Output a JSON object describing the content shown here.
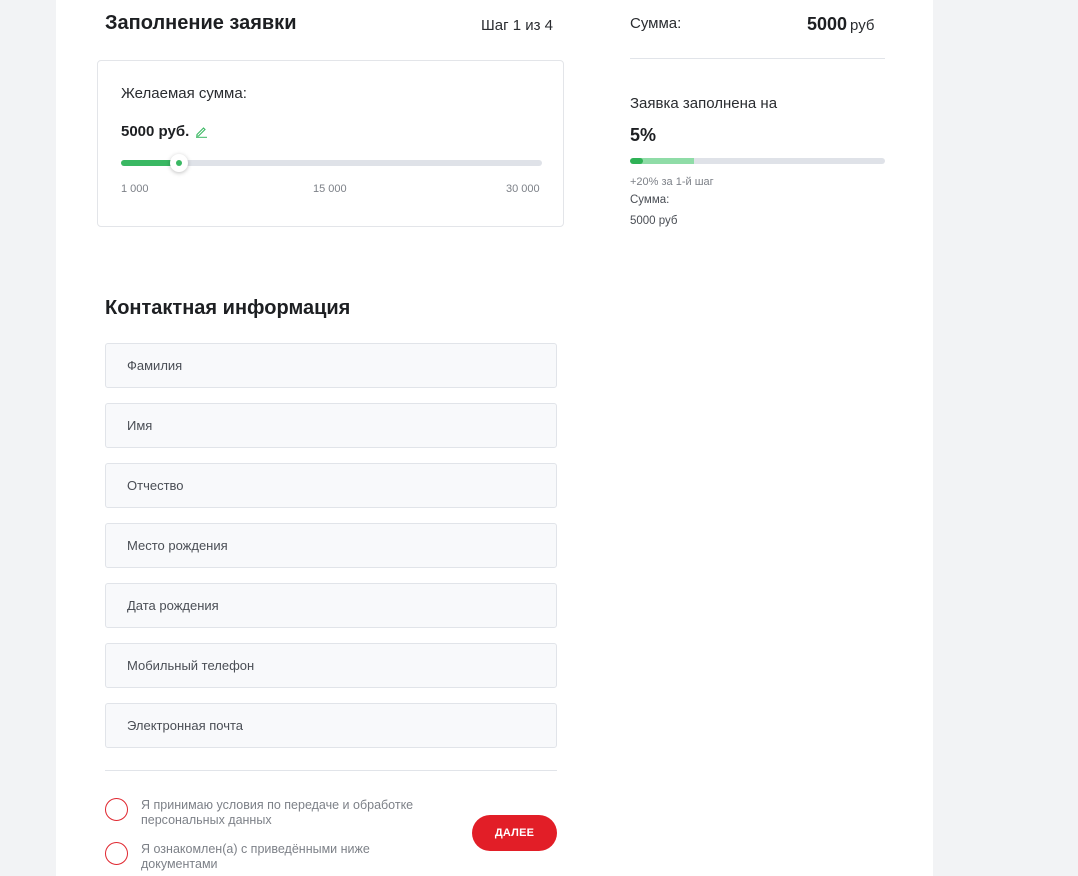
{
  "header": {
    "title": "Заполнение заявки",
    "step": "Шаг 1 из 4"
  },
  "amount": {
    "label": "Желаемая сумма:",
    "value": "5000 руб.",
    "edit_icon": "pencil-icon",
    "slider": {
      "min": 1000,
      "max": 30000,
      "current": 5000,
      "tick_labels": [
        "1 000",
        "15 000",
        "30 000"
      ],
      "color": "#3ab863"
    }
  },
  "contact": {
    "title": "Контактная информация",
    "fields": [
      {
        "name": "last-name-field",
        "placeholder": "Фамилия"
      },
      {
        "name": "first-name-field",
        "placeholder": "Имя"
      },
      {
        "name": "patronymic-field",
        "placeholder": "Отчество"
      },
      {
        "name": "birthplace-field",
        "placeholder": "Место рождения"
      },
      {
        "name": "birthdate-field",
        "placeholder": "Дата рождения"
      },
      {
        "name": "phone-field",
        "placeholder": "Мобильный телефон"
      },
      {
        "name": "email-field",
        "placeholder": "Электронная почта"
      }
    ]
  },
  "consents": [
    {
      "text": "Я принимаю условия по передаче и обработке персональных данных",
      "checked": false
    },
    {
      "text": "Я ознакомлен(а) с приведёнными ниже документами",
      "checked": false
    }
  ],
  "next_button": {
    "label": "ДАЛЕЕ",
    "color": "#e21e27"
  },
  "summary": {
    "sum_label": "Сумма:",
    "sum_value": "5000",
    "sum_unit": "руб",
    "fill_label": "Заявка заполнена на",
    "fill_percent_text": "5%",
    "fill_percent": 5,
    "next_step_percent": 25,
    "progress_hint": "+20% за 1-й шаг",
    "small_sum_label": "Сумма:",
    "small_sum_value": "5000 руб",
    "progress_color": "#2fb256",
    "progress_next_color": "#8fdca7"
  }
}
